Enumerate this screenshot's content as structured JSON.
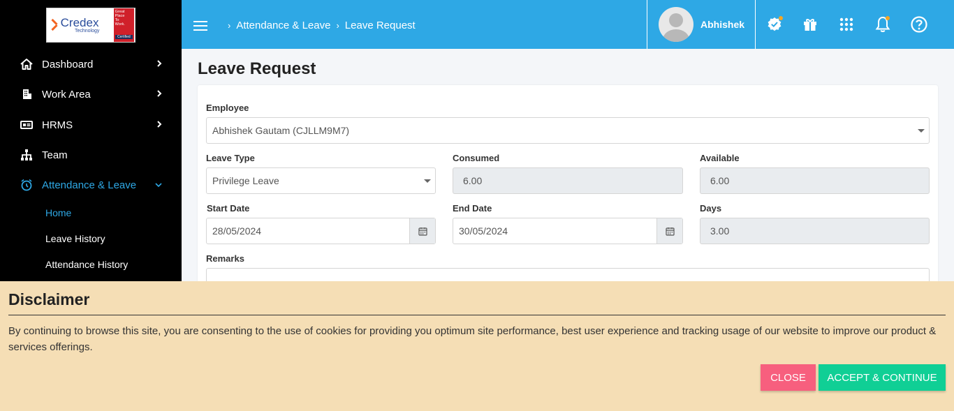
{
  "logo": {
    "name": "Credex",
    "sub": "Technology",
    "badge_lines": [
      "Great",
      "Place",
      "To",
      "Work."
    ],
    "badge_cert": "Certified"
  },
  "sidebar": {
    "items": [
      {
        "label": "Dashboard",
        "icon": "home-icon"
      },
      {
        "label": "Work Area",
        "icon": "building-icon"
      },
      {
        "label": "HRMS",
        "icon": "id-card-icon"
      },
      {
        "label": "Team",
        "icon": "sitemap-icon"
      },
      {
        "label": "Attendance & Leave",
        "icon": "alarm-clock-icon"
      }
    ],
    "sub_items": [
      {
        "label": "Home"
      },
      {
        "label": "Leave History"
      },
      {
        "label": "Attendance History"
      }
    ]
  },
  "header": {
    "breadcrumb": [
      "Attendance & Leave",
      "Leave Request"
    ],
    "user_name": "Abhishek",
    "icons": [
      "approval-badge-icon",
      "gift-icon",
      "apps-grid-icon",
      "bell-icon",
      "help-icon"
    ]
  },
  "form": {
    "title": "Leave Request",
    "employee_label": "Employee",
    "employee_value": "Abhishek Gautam (CJLLM9M7)",
    "leave_type_label": "Leave Type",
    "leave_type_value": "Privilege Leave",
    "consumed_label": "Consumed",
    "consumed_value": "6.00",
    "available_label": "Available",
    "available_value": "6.00",
    "start_date_label": "Start Date",
    "start_date_value": "28/05/2024",
    "end_date_label": "End Date",
    "end_date_value": "30/05/2024",
    "days_label": "Days",
    "days_value": "3.00",
    "remarks_label": "Remarks"
  },
  "disclaimer": {
    "title": "Disclaimer",
    "text": "By continuing to browse this site, you are consenting to the use of cookies for providing you optimum site performance, best user experience and tracking usage of our website to improve our product & services offerings.",
    "close_label": "CLOSE",
    "accept_label": "ACCEPT & CONTINUE"
  },
  "colors": {
    "header": "#2ea8e5",
    "sidebar": "#000000",
    "active": "#2ea8e5",
    "disclaimer_bg": "#f5deb5",
    "close_btn": "#f75f7e",
    "accept_btn": "#10cf95"
  }
}
